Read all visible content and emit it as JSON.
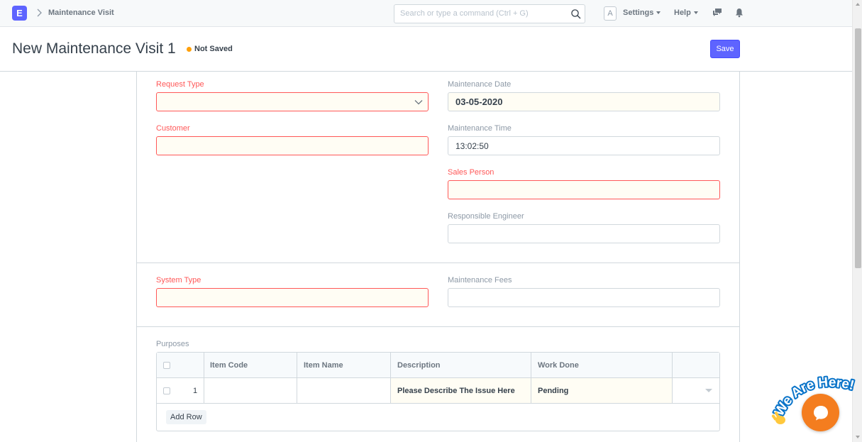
{
  "navbar": {
    "logo_letter": "E",
    "breadcrumb": "Maintenance Visit",
    "search_placeholder": "Search or type a command (Ctrl + G)",
    "avatar_letter": "A",
    "settings_label": "Settings",
    "help_label": "Help",
    "icons": [
      "chevron-right-icon",
      "search-icon",
      "comments-icon",
      "bell-icon"
    ]
  },
  "page": {
    "title": "New Maintenance Visit 1",
    "status": "Not Saved",
    "save_label": "Save",
    "status_color": "#ffa00a",
    "primary_color": "#5e64ff"
  },
  "form": {
    "request_type": {
      "label": "Request Type",
      "value": ""
    },
    "customer": {
      "label": "Customer",
      "value": ""
    },
    "maintenance_date": {
      "label": "Maintenance Date",
      "value": "03-05-2020"
    },
    "maintenance_time": {
      "label": "Maintenance Time",
      "value": "13:02:50"
    },
    "sales_person": {
      "label": "Sales Person",
      "value": ""
    },
    "responsible_engineer": {
      "label": "Responsible Engineer",
      "value": ""
    },
    "system_type": {
      "label": "System Type",
      "value": ""
    },
    "maintenance_fees": {
      "label": "Maintenance Fees",
      "value": ""
    }
  },
  "purposes": {
    "label": "Purposes",
    "columns": [
      "Item Code",
      "Item Name",
      "Description",
      "Work Done"
    ],
    "rows": [
      {
        "idx": "1",
        "item_code": "",
        "item_name": "",
        "description": "Please Describe The Issue Here",
        "work_done": "Pending"
      }
    ],
    "add_row_label": "Add Row"
  },
  "chat_widget": {
    "text": "We Are Here!",
    "accent_color": "#f47d1f"
  }
}
